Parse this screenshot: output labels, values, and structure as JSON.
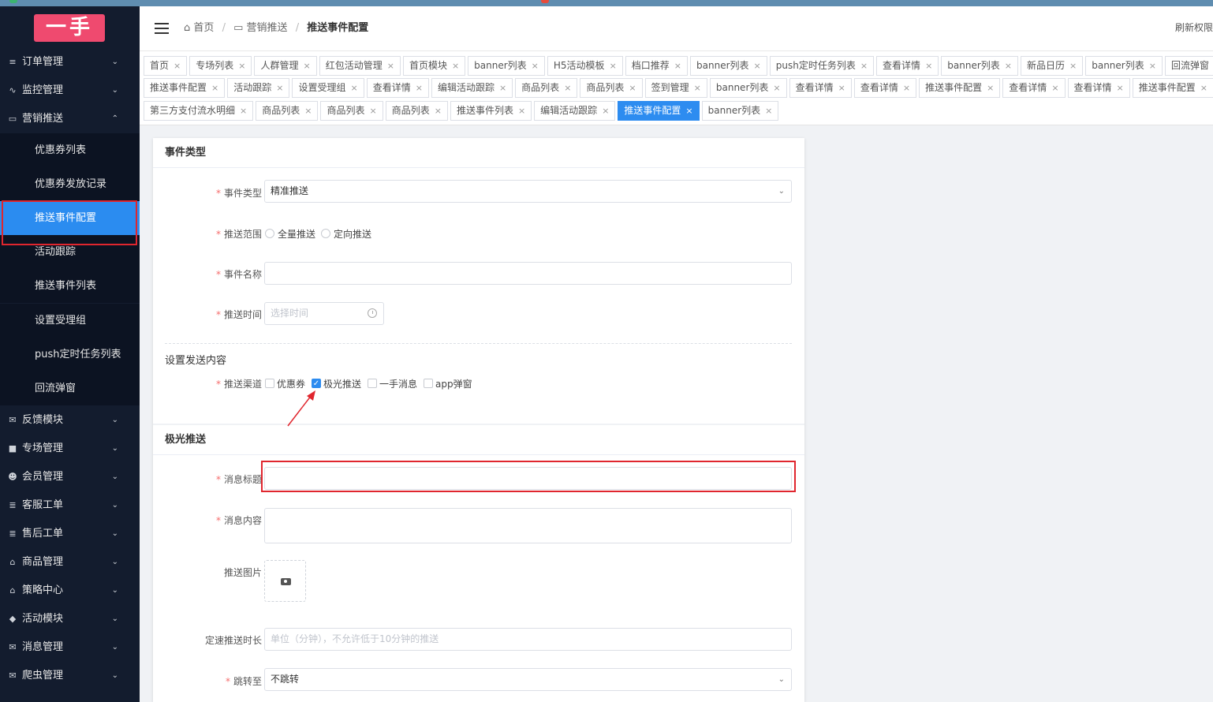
{
  "app": {
    "logo_text": "一手"
  },
  "sidebar": {
    "menus": [
      {
        "label": "订单管理",
        "icon": "list-icon",
        "icon_glyph": "≡",
        "chevron": "⌄"
      },
      {
        "label": "监控管理",
        "icon": "pulse-icon",
        "icon_glyph": "∿",
        "chevron": "⌄"
      },
      {
        "label": "营销推送",
        "icon": "tablet-icon",
        "icon_glyph": "▭",
        "chevron": "⌃"
      }
    ],
    "sub_items": [
      {
        "label": "优惠券列表"
      },
      {
        "label": "优惠券发放记录"
      },
      {
        "label": "推送事件配置"
      },
      {
        "label": "活动跟踪"
      },
      {
        "label": "推送事件列表"
      },
      {
        "label": "设置受理组"
      },
      {
        "label": "push定时任务列表"
      },
      {
        "label": "回流弹窗"
      }
    ],
    "menus2": [
      {
        "label": "反馈模块",
        "icon": "mail-icon",
        "icon_glyph": "✉"
      },
      {
        "label": "专场管理",
        "icon": "square-icon",
        "icon_glyph": "■"
      },
      {
        "label": "会员管理",
        "icon": "users-icon",
        "icon_glyph": "☻"
      },
      {
        "label": "客服工单",
        "icon": "document-icon",
        "icon_glyph": "≣"
      },
      {
        "label": "售后工单",
        "icon": "file-icon",
        "icon_glyph": "≣"
      },
      {
        "label": "商品管理",
        "icon": "shirt-icon",
        "icon_glyph": "⌂"
      },
      {
        "label": "策略中心",
        "icon": "shirt-icon",
        "icon_glyph": "⌂"
      },
      {
        "label": "活动模块",
        "icon": "gamepad-icon",
        "icon_glyph": "◆"
      },
      {
        "label": "消息管理",
        "icon": "envelope-icon",
        "icon_glyph": "✉"
      },
      {
        "label": "爬虫管理",
        "icon": "envelope-icon",
        "icon_glyph": "✉"
      }
    ],
    "chevron_down": "⌄"
  },
  "header": {
    "breadcrumb": {
      "home": "首页",
      "section": "营销推送",
      "current": "推送事件配置",
      "sep": "/"
    },
    "refresh_label": "刷新权限"
  },
  "tabs": {
    "row1": [
      "首页",
      "专场列表",
      "人群管理",
      "红包活动管理",
      "首页模块",
      "banner列表",
      "H5活动模板",
      "档口推荐",
      "banner列表",
      "push定时任务列表",
      "查看详情",
      "banner列表",
      "新品日历",
      "banner列表",
      "回流弹窗"
    ],
    "row2": [
      "推送事件配置",
      "活动跟踪",
      "设置受理组",
      "查看详情",
      "编辑活动跟踪",
      "商品列表",
      "商品列表",
      "签到管理",
      "banner列表",
      "查看详情",
      "查看详情",
      "推送事件配置",
      "查看详情",
      "查看详情",
      "推送事件配置"
    ],
    "row3": [
      "第三方支付流水明细",
      "商品列表",
      "商品列表",
      "商品列表",
      "推送事件列表",
      "编辑活动跟踪",
      "推送事件配置",
      "banner列表"
    ],
    "active_row": 3,
    "active_index": 6,
    "close_glyph": "×"
  },
  "form": {
    "section1_title": "事件类型",
    "event_type": {
      "label": "事件类型",
      "value": "精准推送"
    },
    "push_scope": {
      "label": "推送范围",
      "options": [
        "全量推送",
        "定向推送"
      ]
    },
    "event_name": {
      "label": "事件名称",
      "value": ""
    },
    "push_time": {
      "label": "推送时间",
      "placeholder": "选择时间"
    },
    "content_title": "设置发送内容",
    "channel": {
      "label": "推送渠道",
      "options": [
        {
          "label": "优惠券",
          "checked": false
        },
        {
          "label": "极光推送",
          "checked": true
        },
        {
          "label": "一手消息",
          "checked": false
        },
        {
          "label": "app弹窗",
          "checked": false
        }
      ],
      "check_glyph": "✓"
    },
    "section2_title": "极光推送",
    "msg_title": {
      "label": "消息标题",
      "value": ""
    },
    "msg_content": {
      "label": "消息内容",
      "value": ""
    },
    "push_image": {
      "label": "推送图片"
    },
    "delay": {
      "label": "定速推送时长",
      "placeholder": "单位（分钟），不允许低于10分钟的推送"
    },
    "jump": {
      "label": "跳转至",
      "value": "不跳转"
    },
    "required_mark": "*"
  },
  "colors": {
    "sidebar_bg": "#131c2e",
    "active_blue": "#2b8cf0",
    "highlight_red": "#e0262e",
    "logo_pink": "#ef4a6f"
  }
}
